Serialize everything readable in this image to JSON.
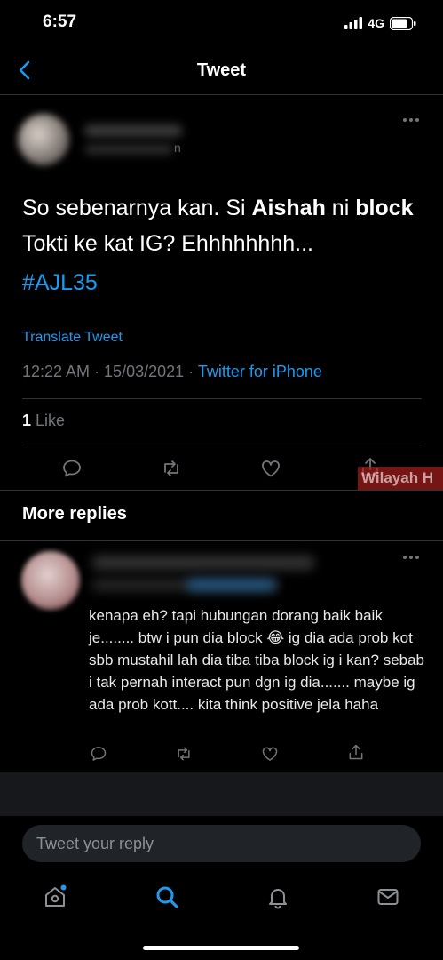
{
  "status_bar": {
    "time": "6:57",
    "network": "4G"
  },
  "header": {
    "title": "Tweet"
  },
  "tweet": {
    "handle_tail": "n",
    "text_prefix": "So sebenarnya kan. Si ",
    "text_bold1": "Aishah",
    "text_mid": " ni ",
    "text_bold2": "block",
    "text_suffix": " Tokti ke kat IG? Ehhhhhhhh...",
    "hashtag": "#AJL35",
    "translate_label": "Translate Tweet",
    "timestamp": "12:22 AM · 15/03/2021 · ",
    "source": "Twitter for iPhone",
    "like_count": "1",
    "like_label": " Like"
  },
  "watermark": "Wilayah H",
  "more_replies": {
    "heading": "More replies"
  },
  "reply": {
    "text": "kenapa eh? tapi hubungan dorang baik baik je........ btw i pun dia block 😂 ig dia ada prob kot sbb mustahil lah dia tiba tiba block ig i kan? sebab i tak pernah interact pun dgn ig dia....... maybe ig ada prob kott.... kita think positive jela haha"
  },
  "reply_box": {
    "placeholder": "Tweet your reply"
  },
  "colors": {
    "accent": "#1d9bf0",
    "muted": "#71767b",
    "background": "#000000"
  },
  "icons": [
    "back-arrow-icon",
    "more-icon",
    "reply-icon",
    "retweet-icon",
    "like-icon",
    "share-icon",
    "home-icon",
    "search-icon",
    "notifications-icon",
    "messages-icon"
  ]
}
